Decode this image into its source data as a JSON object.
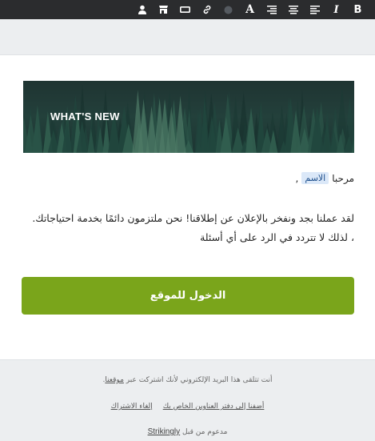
{
  "toolbar": {
    "items": [
      {
        "name": "bold",
        "label": "B"
      },
      {
        "name": "italic",
        "label": "I"
      },
      {
        "name": "align-left",
        "icon": "align-left-icon"
      },
      {
        "name": "align-center",
        "icon": "align-center-icon"
      },
      {
        "name": "align-right",
        "icon": "align-right-icon"
      },
      {
        "name": "font",
        "label": "A"
      },
      {
        "name": "color",
        "icon": "color-dot-icon"
      },
      {
        "name": "link",
        "icon": "link-icon"
      },
      {
        "name": "button",
        "icon": "button-icon"
      },
      {
        "name": "store",
        "icon": "store-icon"
      },
      {
        "name": "user",
        "icon": "user-icon"
      }
    ],
    "colors": {
      "background": "#2b2c2e",
      "dot": "#555a60"
    }
  },
  "banner": {
    "text": "WHAT'S NEW"
  },
  "greeting": {
    "prefix": "مرحبا",
    "name_tag": "الاسم",
    "suffix": ","
  },
  "body": {
    "line1": "لقد عملنا بجد ونفخر بالإعلان عن إطلاقنا! نحن ملتزمون دائمًا بخدمة احتياجاتك.",
    "line2": "، لذلك لا تتردد في الرد على أي أسئلة"
  },
  "cta": {
    "label": "الدخول للموقع",
    "color": "#7aa51b"
  },
  "footer": {
    "line1_text": "أنت تتلقى هذا البريد الإلكتروني لأنك اشتركت عبر",
    "line1_link": "موقعنا",
    "line1_end": ".",
    "add_address_link": "أضفنا إلى دفتر العناوين الخاص بك",
    "unsubscribe_link": "إلغاء الاشتراك",
    "powered_text": "مدعوم من قبل",
    "powered_brand": "Strikingly"
  }
}
